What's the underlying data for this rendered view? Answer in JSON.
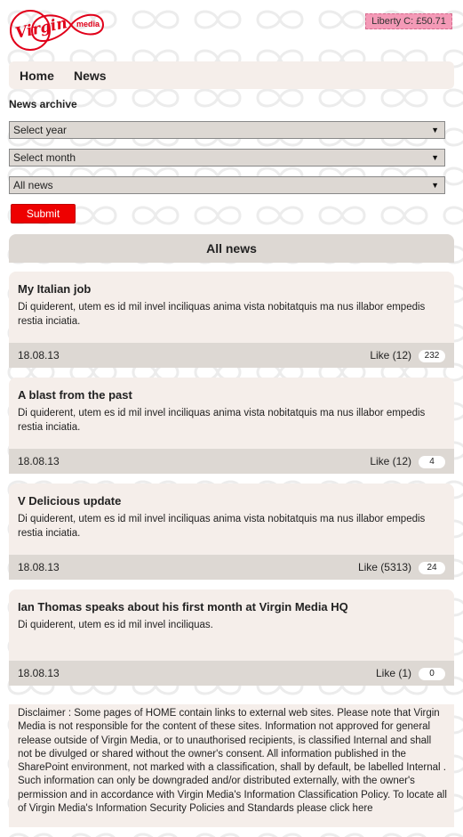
{
  "header": {
    "logo_text": "Virgin",
    "logo_subtext": "media",
    "credit": "Liberty C: £50.71"
  },
  "nav": {
    "items": [
      "Home",
      "News"
    ]
  },
  "archive": {
    "label": "News archive",
    "year_select": "Select year",
    "month_select": "Select month",
    "category_select": "All news",
    "submit_label": "Submit"
  },
  "section_title": "All news",
  "news": [
    {
      "title": "My Italian job",
      "body": "Di quiderent, utem es id mil invel inciliquas anima vista nobitatquis ma nus illabor empedis restia inciatia.",
      "date": "18.08.13",
      "like": "Like (12)",
      "count": "232"
    },
    {
      "title": "A blast from the past",
      "body": "Di quiderent, utem es id mil invel inciliquas anima vista nobitatquis ma nus illabor empedis restia inciatia.",
      "date": "18.08.13",
      "like": "Like (12)",
      "count": "4"
    },
    {
      "title": "V Delicious update",
      "body": "Di quiderent, utem es id mil invel inciliquas anima vista nobitatquis ma nus illabor empedis restia inciatia.",
      "date": "18.08.13",
      "like": "Like (5313)",
      "count": "24"
    },
    {
      "title": "Ian Thomas speaks about his first month at Virgin Media HQ",
      "body": "Di quiderent, utem es id mil invel inciliquas.",
      "date": "18.08.13",
      "like": "Like (1)",
      "count": "0"
    }
  ],
  "disclaimer": "Disclaimer : Some pages of HOME contain links to external web sites. Please note that Virgin Media is not responsible for the content of these sites. Information not approved for general release outside of Virgin Media, or to unauthorised recipients, is classified Internal and shall not be divulged or shared without the owner's consent. All information published in the SharePoint environment, not marked with a classification, shall by default, be labelled Internal . Such information can only be downgraded and/or distributed externally, with the owner's permission and in accordance with Virgin Media's Information Classification Policy. To locate all of Virgin Media's Information Security Policies and Standards please click here",
  "colors": {
    "brand_red": "#ee0000",
    "credit_pink": "#f49ab7",
    "panel": "#f5eeea",
    "bar": "#ddd8d3"
  }
}
